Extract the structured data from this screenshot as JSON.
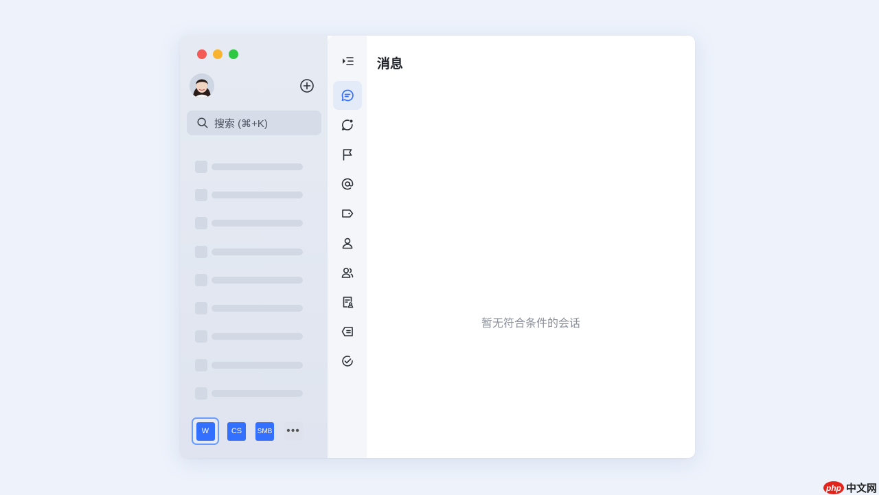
{
  "sidebar": {
    "add_icon": "plus-circle-icon",
    "search": {
      "label": "搜索 (⌘+K)",
      "icon": "search-icon"
    },
    "skeleton_rows": 9,
    "workspaces": [
      {
        "label": "W",
        "active": true
      },
      {
        "label": "CS",
        "active": false
      },
      {
        "label": "SMB",
        "active": false
      }
    ],
    "more_label": "•••"
  },
  "rail": {
    "items": [
      {
        "icon": "message-icon",
        "active": true
      },
      {
        "icon": "chat-dot-icon",
        "active": false
      },
      {
        "icon": "flag-icon",
        "active": false
      },
      {
        "icon": "at-icon",
        "active": false
      },
      {
        "icon": "tag-icon",
        "active": false
      },
      {
        "icon": "user-icon",
        "active": false
      },
      {
        "icon": "group-icon",
        "active": false
      },
      {
        "icon": "document-icon",
        "active": false
      },
      {
        "icon": "inbox-icon",
        "active": false
      },
      {
        "icon": "check-circle-icon",
        "active": false
      }
    ]
  },
  "main": {
    "title": "消息",
    "empty_text": "暂无符合条件的会话"
  },
  "watermark": {
    "badge": "php",
    "text": "中文网"
  },
  "colors": {
    "accent": "#3370ff",
    "background": "#edf2fb"
  }
}
